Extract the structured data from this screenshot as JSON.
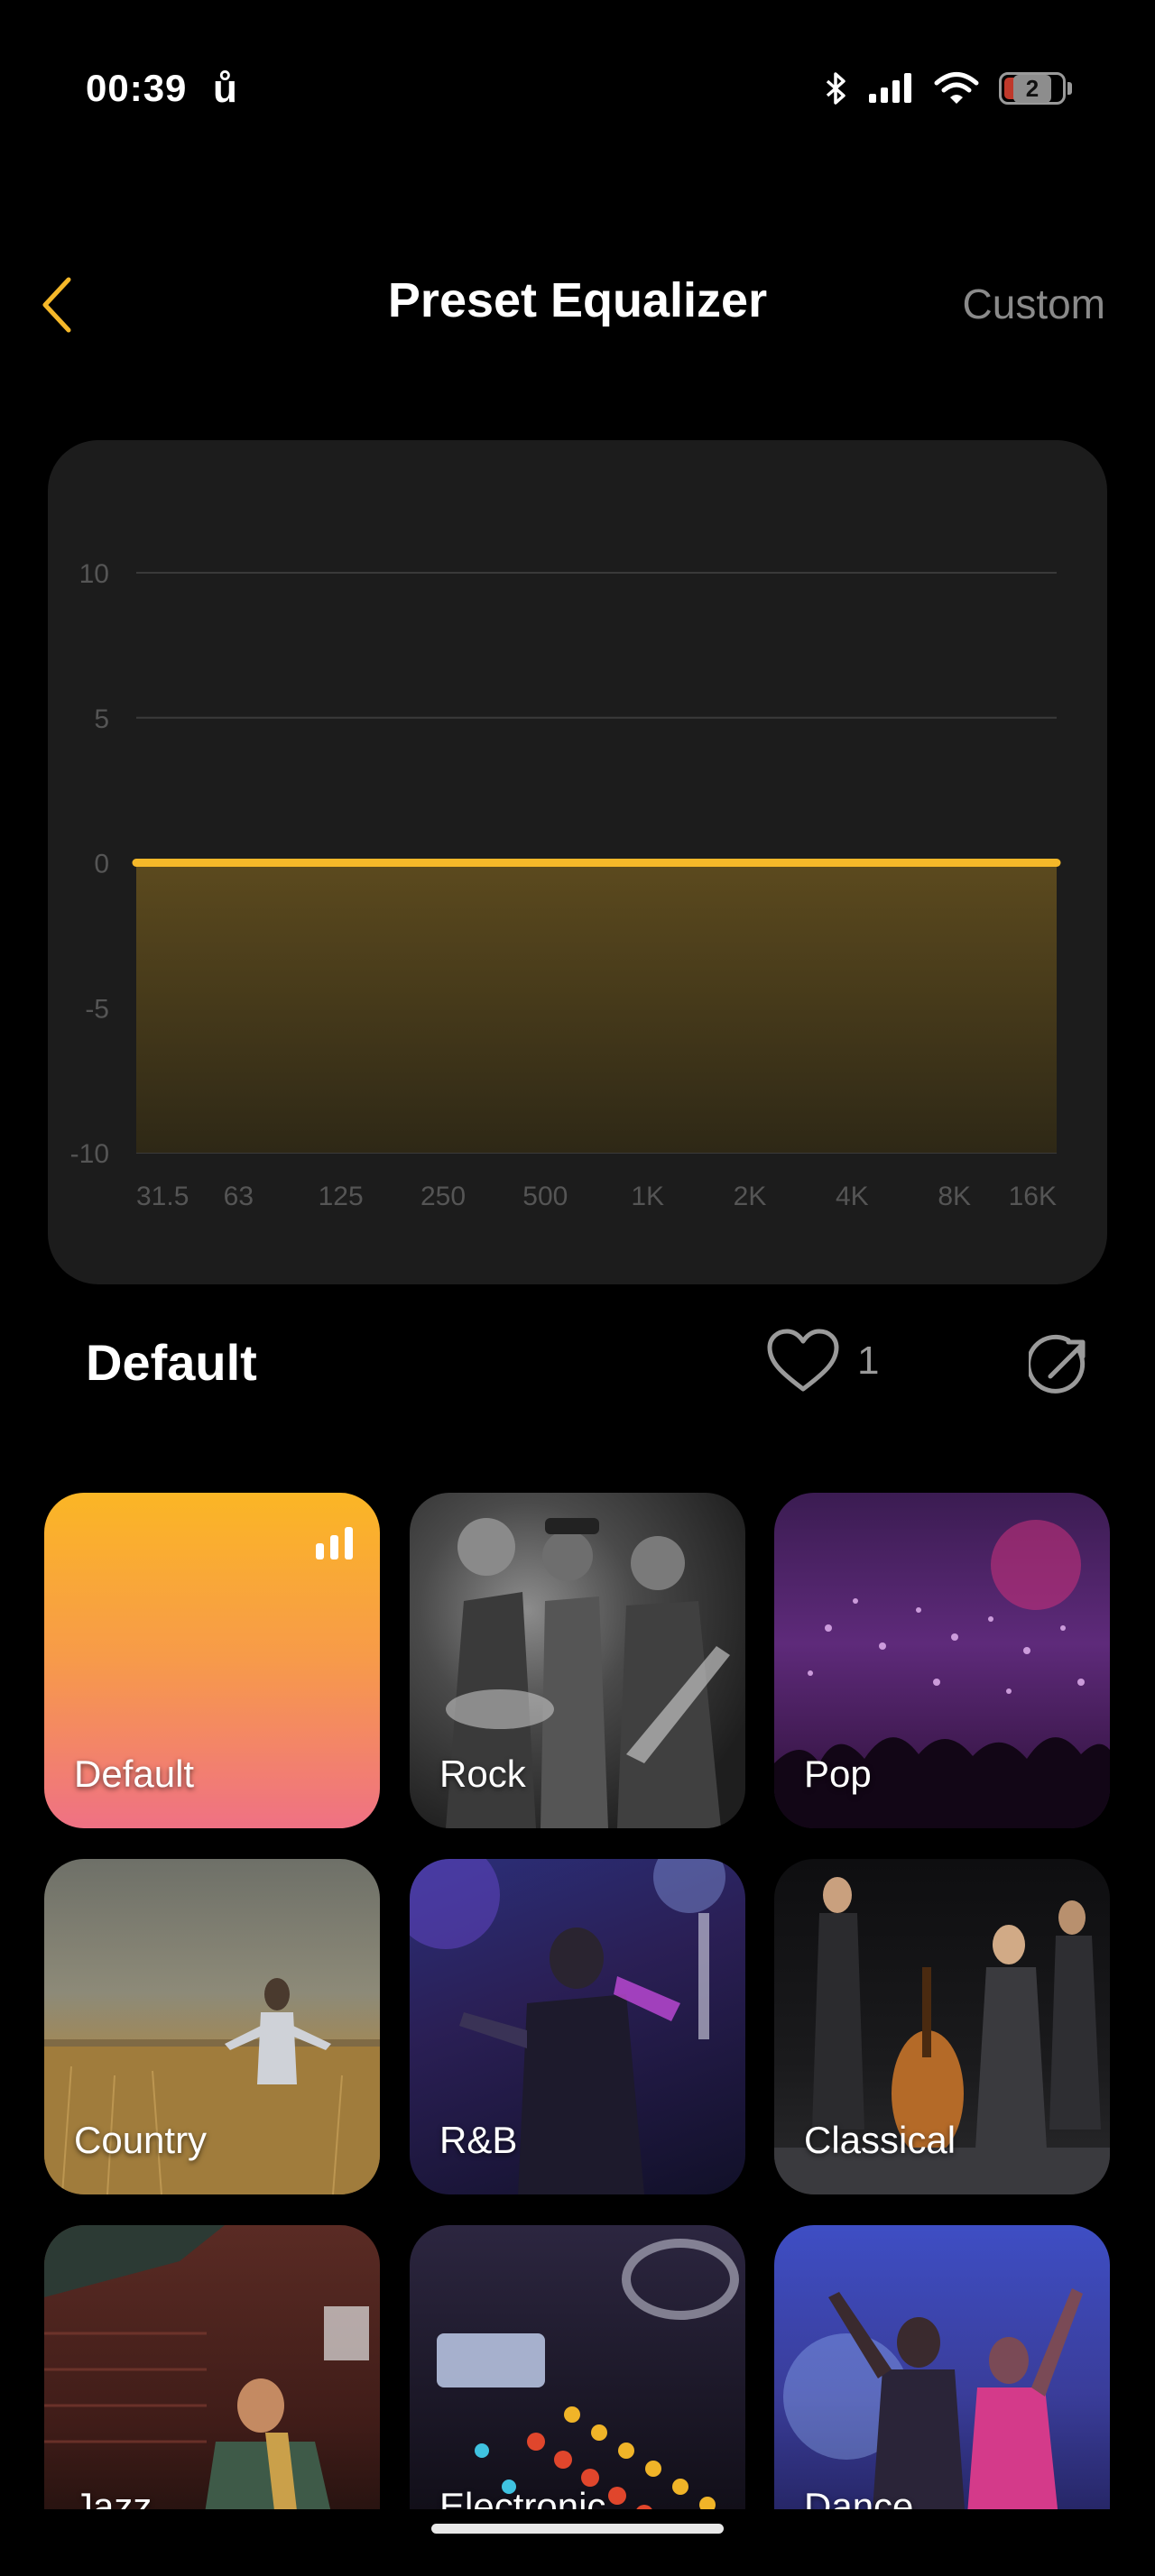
{
  "status_bar": {
    "time": "00:39",
    "app_icon": "ů",
    "battery_level": "2"
  },
  "header": {
    "title": "Preset Equalizer",
    "custom_label": "Custom"
  },
  "chart_data": {
    "type": "area",
    "x": [
      "31.5",
      "63",
      "125",
      "250",
      "500",
      "1K",
      "2K",
      "4K",
      "8K",
      "16K"
    ],
    "series": [
      {
        "values": [
          0,
          0,
          0,
          0,
          0,
          0,
          0,
          0,
          0,
          0
        ]
      }
    ],
    "y_ticks": [
      "10",
      "5",
      "0",
      "-5",
      "-10"
    ],
    "ylim": [
      -10,
      10
    ],
    "grid": true,
    "line_color": "#f5b829",
    "fill_color": "#5c4a1e"
  },
  "preset": {
    "name": "Default",
    "like_count": "1"
  },
  "presets": [
    {
      "label": "Default"
    },
    {
      "label": "Rock"
    },
    {
      "label": "Pop"
    },
    {
      "label": "Country"
    },
    {
      "label": "R&B"
    },
    {
      "label": "Classical"
    },
    {
      "label": "Jazz"
    },
    {
      "label": "Electronic"
    },
    {
      "label": "Dance"
    }
  ],
  "colors": {
    "accent": "#f5b829",
    "card": "#1c1c1c",
    "muted": "#8a8a8a"
  }
}
